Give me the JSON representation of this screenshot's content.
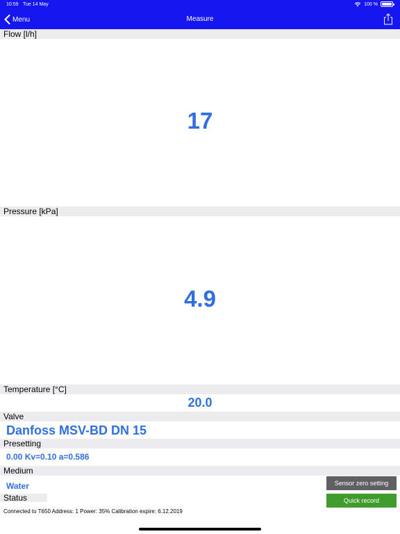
{
  "status_bar": {
    "time": "10:59",
    "date": "Tue 14 May",
    "battery_text": "100 %",
    "battery_level": 1.0
  },
  "nav": {
    "back_label": "Menu",
    "title": "Measure",
    "share_icon": "share-icon"
  },
  "flow": {
    "label": "Flow [l/h]",
    "value": "17"
  },
  "pressure": {
    "label": "Pressure [kPa]",
    "value": "4.9"
  },
  "temperature": {
    "label": "Temperature [°C]",
    "value": "20.0"
  },
  "valve": {
    "label": "Valve",
    "value": "Danfoss MSV-BD DN 15"
  },
  "presetting": {
    "label": "Presetting",
    "value": "0.00 Kv=0.10 a=0.586"
  },
  "medium": {
    "label": "Medium",
    "value": "Water"
  },
  "status": {
    "label": "Status"
  },
  "buttons": {
    "sensor_zero": "Sensor zero setting",
    "quick_record": "Quick record"
  },
  "footer": {
    "connection": "Connected to T650 Address: 1 Power: 35% Calibration expire: 6.12.2019"
  },
  "colors": {
    "nav_blue": "#1616f0",
    "value_blue": "#2f6fe0",
    "header_gray": "#ebebf0",
    "button_gray": "#5f5f64",
    "button_green": "#3e9b2c"
  }
}
